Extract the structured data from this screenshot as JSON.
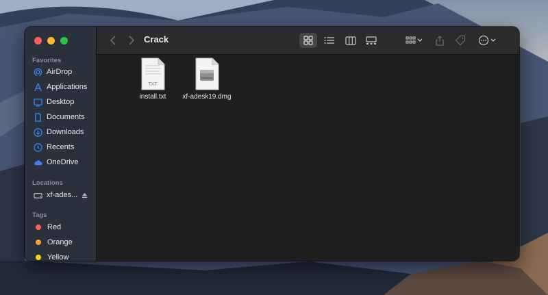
{
  "window": {
    "title": "Crack"
  },
  "sidebar": {
    "favorites_title": "Favorites",
    "favorites": [
      {
        "label": "AirDrop",
        "icon": "airdrop-icon"
      },
      {
        "label": "Applications",
        "icon": "applications-icon"
      },
      {
        "label": "Desktop",
        "icon": "desktop-icon"
      },
      {
        "label": "Documents",
        "icon": "document-icon"
      },
      {
        "label": "Downloads",
        "icon": "download-icon"
      },
      {
        "label": "Recents",
        "icon": "clock-icon"
      },
      {
        "label": "OneDrive",
        "icon": "cloud-icon"
      }
    ],
    "locations_title": "Locations",
    "locations": [
      {
        "label": "xf-ades...",
        "icon": "disk-icon",
        "eject_icon": "eject-icon"
      }
    ],
    "tags_title": "Tags",
    "tags": [
      {
        "label": "Red",
        "color": "#ff5f57"
      },
      {
        "label": "Orange",
        "color": "#f7a32b"
      },
      {
        "label": "Yellow",
        "color": "#f5d31c"
      }
    ]
  },
  "files": [
    {
      "name": "install.txt",
      "type_label": "TXT",
      "icon": "text-file-icon"
    },
    {
      "name": "xf-adesk19.dmg",
      "icon": "disk-image-icon"
    }
  ],
  "colors": {
    "accent": "#3b82f6",
    "window_bg": "#1f1f1f",
    "sidebar_bg": "#2c3240"
  }
}
